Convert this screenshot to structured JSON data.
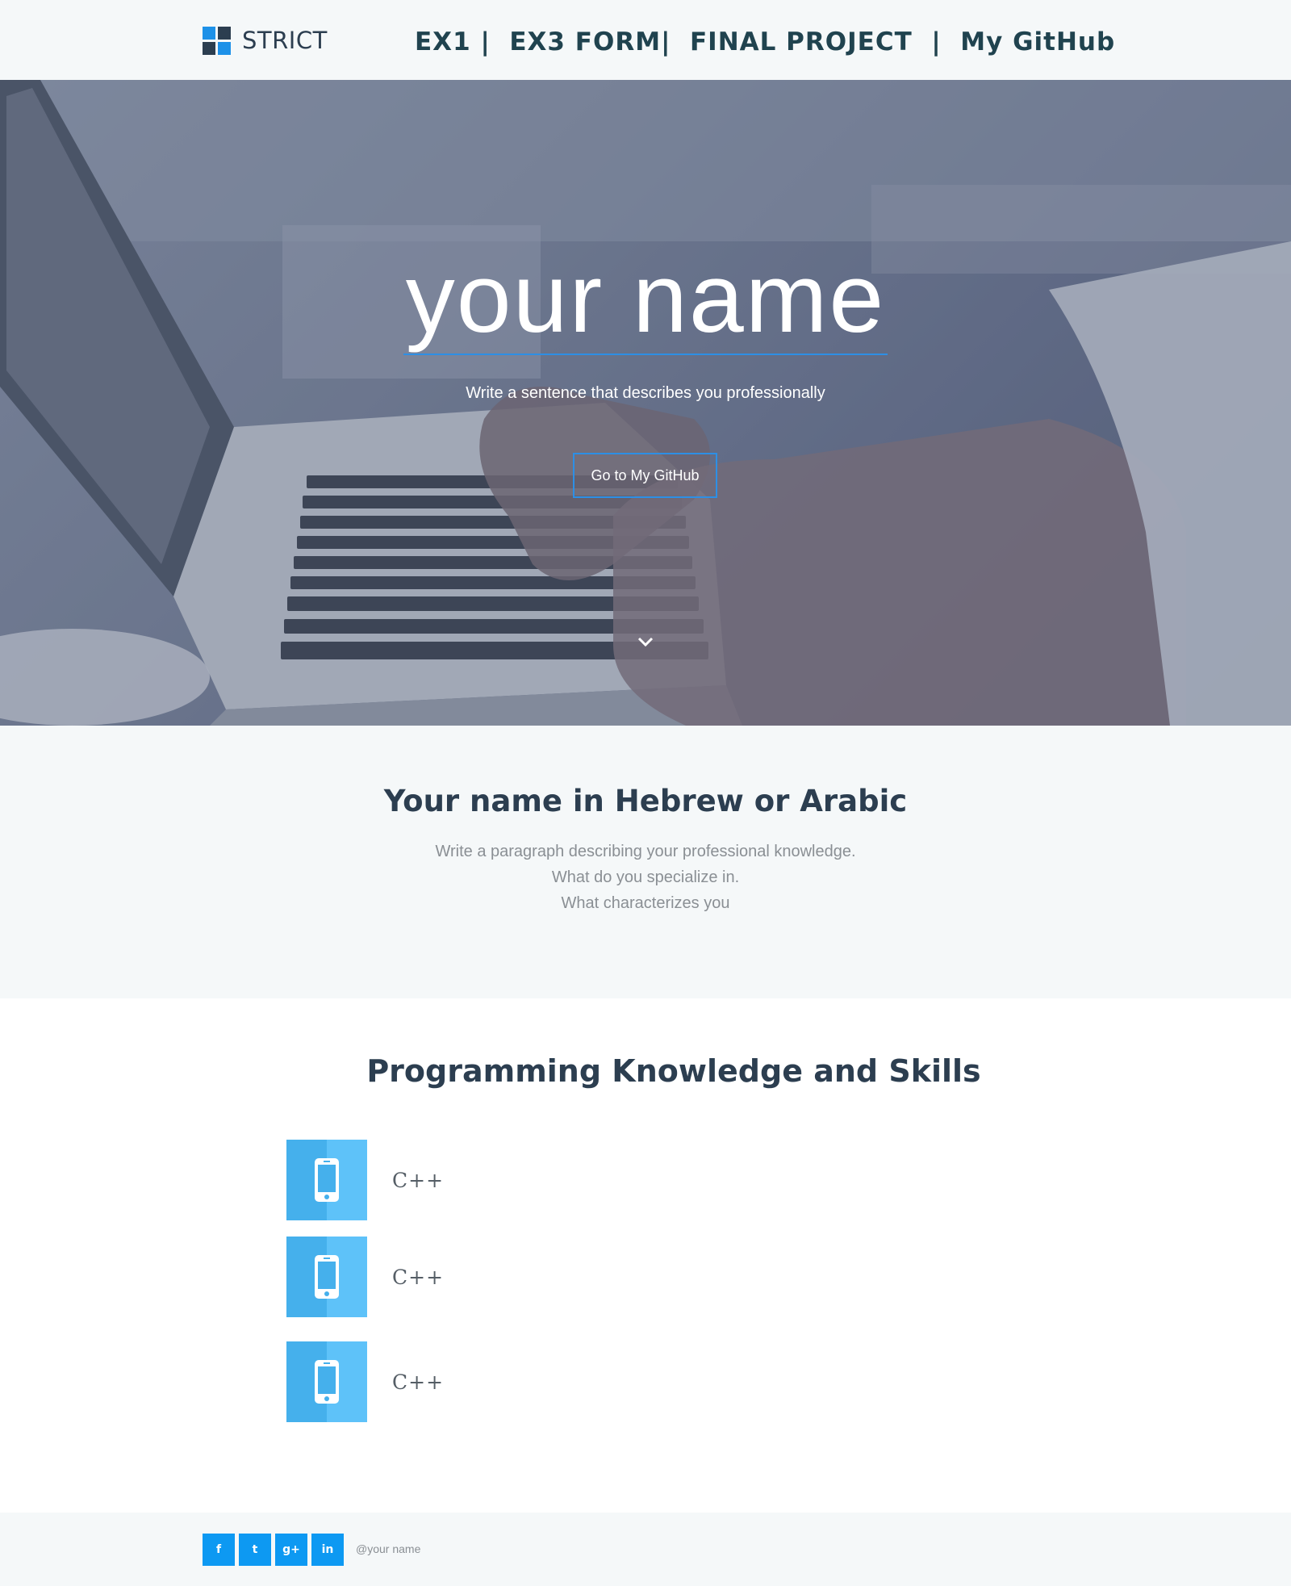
{
  "navbar": {
    "brand": "STRICT",
    "links": [
      "EX1",
      "EX3 FORM",
      "FINAL PROJECT",
      "My GitHub"
    ]
  },
  "hero": {
    "title": "your name",
    "subtitle": "Write a sentence that describes you professionally",
    "button_label": "Go to My GitHub"
  },
  "about": {
    "title": "Your name in Hebrew or Arabic",
    "lines": [
      "Write a paragraph describing your professional knowledge.",
      "What do you specialize in.",
      "What characterizes you"
    ]
  },
  "skills": {
    "title": "Programming Knowledge and Skills",
    "items": [
      {
        "label": "C++",
        "icon": "smartphone-icon"
      },
      {
        "label": "C++",
        "icon": "smartphone-icon"
      },
      {
        "label": "C++",
        "icon": "smartphone-icon"
      }
    ]
  },
  "footer": {
    "social": [
      {
        "glyph": "f",
        "icon": "facebook-icon"
      },
      {
        "glyph": "t",
        "icon": "twitter-icon"
      },
      {
        "glyph": "g+",
        "icon": "google-plus-icon"
      },
      {
        "glyph": "in",
        "icon": "linkedin-icon"
      }
    ],
    "handle": "@your name"
  },
  "colors": {
    "accent": "#1d91e8",
    "dark": "#2c3e50",
    "nav_text": "#20434f",
    "section_bg": "#f5f8f9",
    "skill_tile": "#45b0ec"
  }
}
